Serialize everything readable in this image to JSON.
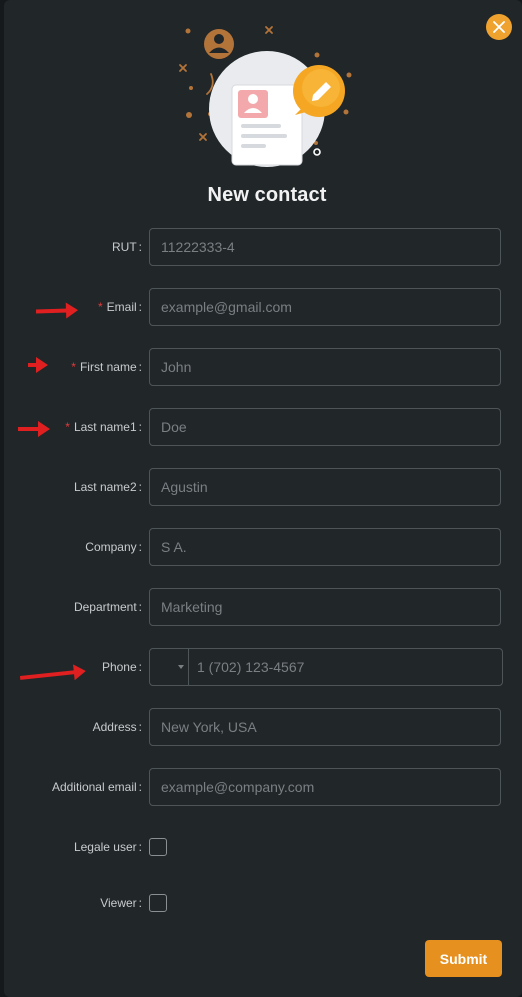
{
  "modal": {
    "title": "New contact",
    "close_icon": "close-icon",
    "submit_label": "Submit",
    "accent_color": "#f0a22f",
    "required_color": "#e23b3b"
  },
  "fields": {
    "rut": {
      "label": "RUT",
      "placeholder": "11222333-4",
      "required": false
    },
    "email": {
      "label": "Email",
      "placeholder": "example@gmail.com",
      "required": true
    },
    "first_name": {
      "label": "First name",
      "placeholder": "John",
      "required": true
    },
    "last_name1": {
      "label": "Last name1",
      "placeholder": "Doe",
      "required": true
    },
    "last_name2": {
      "label": "Last name2",
      "placeholder": "Agustin",
      "required": false
    },
    "company": {
      "label": "Company",
      "placeholder": "S A.",
      "required": false
    },
    "department": {
      "label": "Department",
      "placeholder": "Marketing",
      "required": false
    },
    "phone": {
      "label": "Phone",
      "placeholder": "1 (702) 123-4567",
      "country_icon": "chevron-down-icon",
      "required": false
    },
    "address": {
      "label": "Address",
      "placeholder": "New York, USA",
      "required": false
    },
    "additional_email": {
      "label": "Additional email",
      "placeholder": "example@company.com",
      "required": false
    },
    "legale_user": {
      "label": "Legale user",
      "checked": false
    },
    "viewer": {
      "label": "Viewer",
      "checked": false
    }
  },
  "annotations": {
    "arrow_color": "#e02020",
    "arrow_targets": [
      "Email",
      "First name",
      "Last name1",
      "Phone"
    ]
  }
}
